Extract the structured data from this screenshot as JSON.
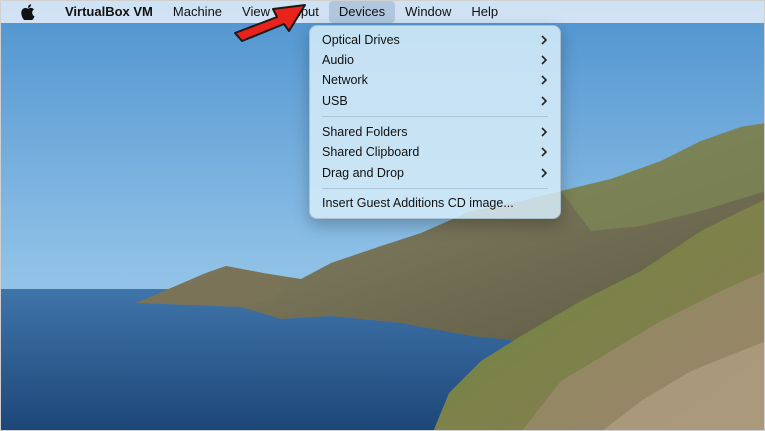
{
  "menubar": {
    "apple_icon": "apple-logo-icon",
    "items": [
      {
        "label": "VirtualBox VM"
      },
      {
        "label": "Machine"
      },
      {
        "label": "View"
      },
      {
        "label": "Input"
      },
      {
        "label": "Devices"
      },
      {
        "label": "Window"
      },
      {
        "label": "Help"
      }
    ],
    "active_menu": "Devices"
  },
  "devices_menu": {
    "items": [
      {
        "label": "Optical Drives",
        "submenu": true
      },
      {
        "label": "Audio",
        "submenu": true
      },
      {
        "label": "Network",
        "submenu": true
      },
      {
        "label": "USB",
        "submenu": true
      },
      {
        "label": "Shared Folders",
        "submenu": true
      },
      {
        "label": "Shared Clipboard",
        "submenu": true
      },
      {
        "label": "Drag and Drop",
        "submenu": true
      },
      {
        "label": "Insert Guest Additions CD image...",
        "submenu": false
      }
    ]
  },
  "annotation": {
    "arrow_color": "#e8231c",
    "icon": "red-pointer-arrow-icon"
  }
}
